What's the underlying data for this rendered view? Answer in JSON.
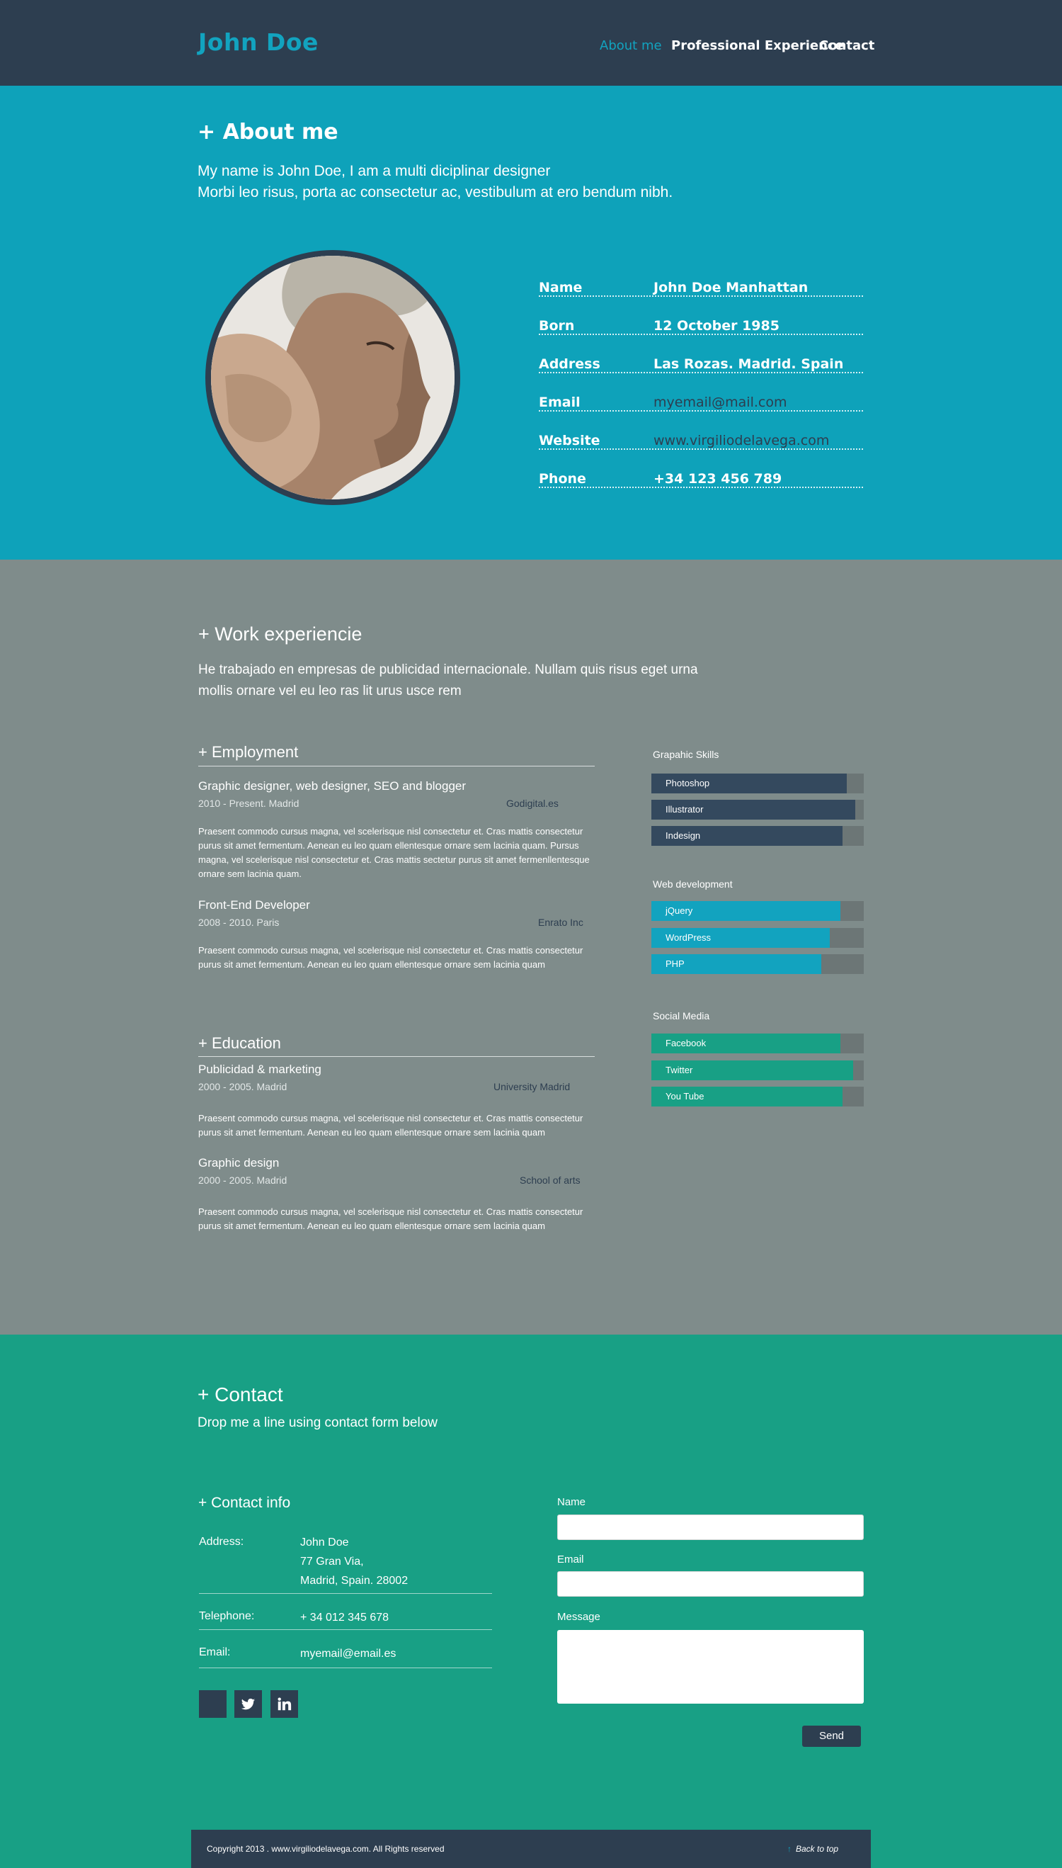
{
  "header": {
    "brand": "John Doe",
    "nav": [
      "About me",
      "Professional Experience",
      "Contact"
    ]
  },
  "about": {
    "title": "+ About me",
    "text_1": "My name is John Doe, I am a multi diciplinar designer",
    "text_2": "Morbi leo risus, porta ac consectetur ac, vestibulum at ero bendum nibh.",
    "info": [
      {
        "label": "Name",
        "value": "John Doe Manhattan"
      },
      {
        "label": "Born",
        "value": "12 October 1985"
      },
      {
        "label": "Address",
        "value": "Las Rozas. Madrid. Spain"
      },
      {
        "label": "Email",
        "value": "myemail@mail.com"
      },
      {
        "label": "Website",
        "value": "www.virgiliodelavega.com"
      },
      {
        "label": "Phone",
        "value": "+34 123 456 789"
      }
    ]
  },
  "work": {
    "title": "+ Work experiencie",
    "text_1": "He trabajado en empresas de publicidad internacionale. Nullam quis risus eget urna",
    "text_2": "mollis ornare vel eu leo ras lit urus usce rem",
    "employment_title": "+ Employment",
    "jobs": [
      {
        "title": "Graphic designer, web designer, SEO and blogger",
        "meta": "2010 - Present. Madrid",
        "company": "Godigital.es",
        "desc": "Praesent commodo cursus magna, vel scelerisque nisl consectetur et. Cras mattis consectetur purus sit amet fermentum. Aenean eu leo quam ellentesque ornare sem lacinia quam. Pursus magna, vel scelerisque nisl consectetur et. Cras mattis sectetur purus sit amet fermenllentesque ornare sem lacinia quam."
      },
      {
        "title": "Front-End Developer",
        "meta": "2008 - 2010. Paris",
        "company": "Enrato Inc",
        "desc": "Praesent commodo cursus magna, vel scelerisque nisl consectetur et. Cras mattis consectetur purus sit amet fermentum. Aenean eu leo quam ellentesque ornare sem lacinia quam"
      }
    ],
    "education_title": "+ Education",
    "education": [
      {
        "title": "Publicidad & marketing",
        "meta": "2000 - 2005. Madrid",
        "company": "University Madrid",
        "desc": "Praesent commodo cursus magna, vel scelerisque nisl consectetur et. Cras mattis consectetur purus sit amet fermentum. Aenean eu leo quam ellentesque ornare sem lacinia quam"
      },
      {
        "title": "Graphic design",
        "meta": "2000 - 2005. Madrid",
        "company": "School of arts",
        "desc": "Praesent commodo cursus magna, vel scelerisque nisl consectetur et. Cras mattis consectetur purus sit amet fermentum. Aenean eu leo quam ellentesque ornare sem lacinia quam"
      }
    ],
    "skill_groups": [
      {
        "title": "Grapahic Skills",
        "color": "#34495e",
        "skills": [
          {
            "name": "Photoshop",
            "level": 0.92
          },
          {
            "name": "Illustrator",
            "level": 0.96
          },
          {
            "name": "Indesign",
            "level": 0.9
          }
        ]
      },
      {
        "title": "Web development",
        "color": "#12a3bf",
        "skills": [
          {
            "name": "jQuery",
            "level": 0.89
          },
          {
            "name": "WordPress",
            "level": 0.84
          },
          {
            "name": "PHP",
            "level": 0.8
          }
        ]
      },
      {
        "title": "Social Media",
        "color": "#18a085",
        "skills": [
          {
            "name": "Facebook",
            "level": 0.89
          },
          {
            "name": "Twitter",
            "level": 0.95
          },
          {
            "name": "You Tube",
            "level": 0.9
          }
        ]
      }
    ]
  },
  "contact": {
    "title": "+ Contact",
    "subtitle": "Drop me a line using contact form below",
    "info_title": "+ Contact info",
    "address_label": "Address:",
    "address_lines": [
      "John Doe",
      "77 Gran Via,",
      "Madrid, Spain. 28002"
    ],
    "telephone_label": "Telephone:",
    "telephone": "+ 34 012 345 678",
    "email_label": "Email:",
    "email": "myemail@email.es",
    "form": {
      "name_label": "Name",
      "email_label": "Email",
      "message_label": "Message",
      "send_label": "Send"
    }
  },
  "footer": {
    "copyright": "Copyright 2013 . www.virgiliodelavega.com. All Rights reserved",
    "back_to_top": "Back to top"
  },
  "colors": {
    "navy": "#2d3e50",
    "cyan": "#0ea2ba",
    "grey": "#7f8c8b",
    "green": "#18a085"
  }
}
